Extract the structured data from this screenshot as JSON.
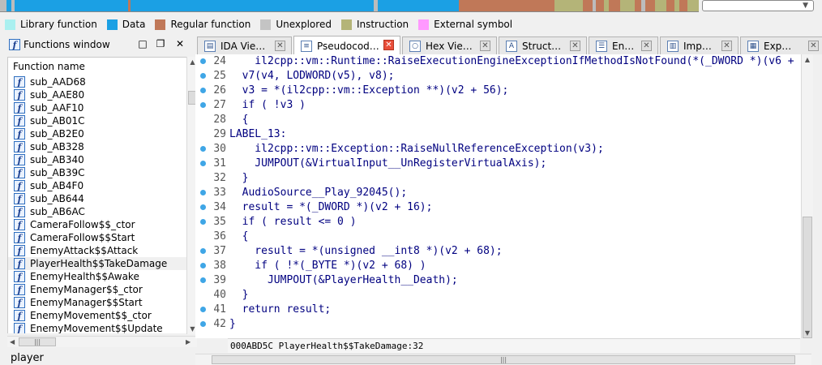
{
  "legend": [
    {
      "label": "Library function",
      "color": "#aaf0f0"
    },
    {
      "label": "Data",
      "color": "#1ba0e4"
    },
    {
      "label": "Regular function",
      "color": "#c07858"
    },
    {
      "label": "Unexplored",
      "color": "#c4c4c4"
    },
    {
      "label": "Instruction",
      "color": "#b4b478"
    },
    {
      "label": "External symbol",
      "color": "#ff99ff"
    }
  ],
  "functions_window": {
    "title": "Functions window",
    "column_header": "Function name",
    "items": [
      "sub_AAD68",
      "sub_AAE80",
      "sub_AAF10",
      "sub_AB01C",
      "sub_AB2E0",
      "sub_AB328",
      "sub_AB340",
      "sub_AB39C",
      "sub_AB4F0",
      "sub_AB644",
      "sub_AB6AC",
      "CameraFollow$$_ctor",
      "CameraFollow$$Start",
      "EnemyAttack$$Attack",
      "PlayerHealth$$TakeDamage",
      "EnemyHealth$$Awake",
      "EnemyManager$$_ctor",
      "EnemyManager$$Start",
      "EnemyMovement$$_ctor",
      "EnemyMovement$$Update"
    ],
    "selected_index": 14,
    "search_text": "player"
  },
  "tabs": [
    {
      "label": "IDA Vie…",
      "icon": "ida-view-icon"
    },
    {
      "label": "Pseudocod…",
      "icon": "pseudocode-icon",
      "active": true
    },
    {
      "label": "Hex Vie…",
      "icon": "hex-view-icon"
    },
    {
      "label": "Struct…",
      "icon": "structures-icon"
    },
    {
      "label": "En…",
      "icon": "enums-icon"
    },
    {
      "label": "Imp…",
      "icon": "imports-icon"
    },
    {
      "label": "Exp…",
      "icon": "exports-icon"
    }
  ],
  "code": {
    "lines": [
      {
        "n": "24",
        "dot": true,
        "text": "    il2cpp::vm::Runtime::RaiseExecutionEngineExceptionIfMethodIsNotFound(*(_DWORD *)(v6 +"
      },
      {
        "n": "25",
        "dot": true,
        "text": "  v7(v4, LODWORD(v5), v8);"
      },
      {
        "n": "26",
        "dot": true,
        "text": "  v3 = *(il2cpp::vm::Exception **)(v2 + 56);"
      },
      {
        "n": "27",
        "dot": true,
        "text": "  if ( !v3 )"
      },
      {
        "n": "28",
        "dot": false,
        "text": "  {"
      },
      {
        "n": "29",
        "dot": false,
        "text": "LABEL_13:"
      },
      {
        "n": "30",
        "dot": true,
        "text": "    il2cpp::vm::Exception::RaiseNullReferenceException(v3);"
      },
      {
        "n": "31",
        "dot": true,
        "text": "    JUMPOUT(&VirtualInput__UnRegisterVirtualAxis);"
      },
      {
        "n": "32",
        "dot": false,
        "text": "  }"
      },
      {
        "n": "33",
        "dot": true,
        "text": "  AudioSource__Play_92045();"
      },
      {
        "n": "34",
        "dot": true,
        "text": "  result = *(_DWORD *)(v2 + 16);"
      },
      {
        "n": "35",
        "dot": true,
        "text": "  if ( result <= 0 )"
      },
      {
        "n": "36",
        "dot": false,
        "text": "  {"
      },
      {
        "n": "37",
        "dot": true,
        "text": "    result = *(unsigned __int8 *)(v2 + 68);"
      },
      {
        "n": "38",
        "dot": true,
        "text": "    if ( !*(_BYTE *)(v2 + 68) )"
      },
      {
        "n": "39",
        "dot": true,
        "text": "      JUMPOUT(&PlayerHealth__Death);"
      },
      {
        "n": "40",
        "dot": false,
        "text": "  }"
      },
      {
        "n": "41",
        "dot": true,
        "text": "  return result;"
      },
      {
        "n": "42",
        "dot": true,
        "text": "}"
      }
    ]
  },
  "status_bar": "000ABD5C PlayerHealth$$TakeDamage:32",
  "nav_band_colors": {
    "unexplored": "#bcbcbc",
    "data": "#1ba0e4",
    "regular": "#c07858",
    "instruction": "#b4b478"
  }
}
